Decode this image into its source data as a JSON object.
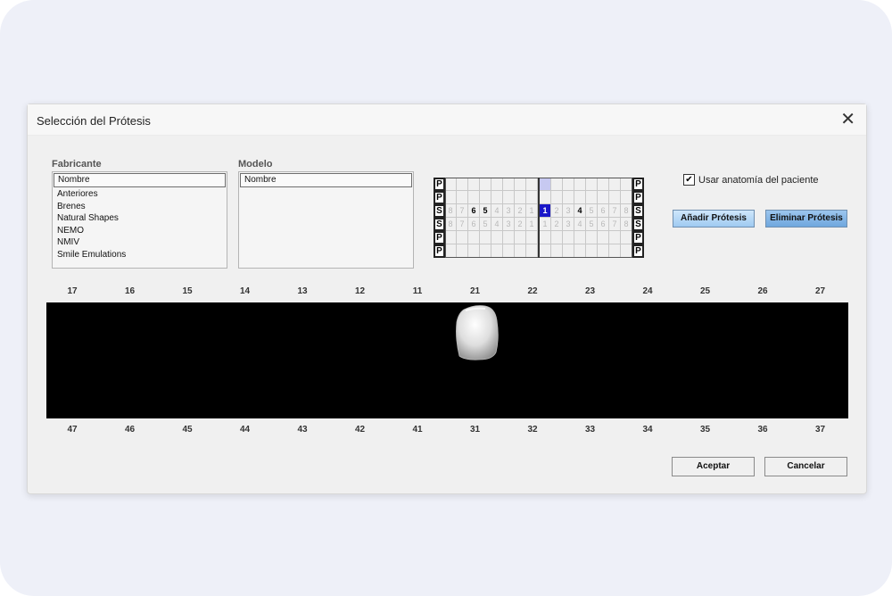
{
  "dialog": {
    "title": "Selección del Prótesis",
    "close_glyph": "✕"
  },
  "fabricante": {
    "label": "Fabricante",
    "header": "Nombre",
    "items": [
      "Anteriores",
      "Brenes",
      "Natural Shapes",
      "NEMO",
      "NMIV",
      "Smile Emulations"
    ]
  },
  "modelo": {
    "label": "Modelo",
    "header": "Nombre",
    "items": []
  },
  "tooth_grid": {
    "row_tags": [
      "P",
      "P",
      "S",
      "S",
      "P",
      "P"
    ],
    "upper_left": [
      "8",
      "7",
      "6",
      "5",
      "4",
      "3",
      "2",
      "1"
    ],
    "upper_right": [
      "1",
      "2",
      "3",
      "4",
      "5",
      "6",
      "7",
      "8"
    ],
    "lower_left": [
      "8",
      "7",
      "6",
      "5",
      "4",
      "3",
      "2",
      "1"
    ],
    "lower_right": [
      "1",
      "2",
      "3",
      "4",
      "5",
      "6",
      "7",
      "8"
    ],
    "selected_tooth": "upper-right-1",
    "emphasized_teeth": [
      "upper-left-6",
      "upper-left-5",
      "upper-right-4"
    ],
    "selected_color": "#1a17c8",
    "highlight_color": "#c7c9f1"
  },
  "options": {
    "use_patient_anatomy_label": "Usar anatomía del paciente",
    "use_patient_anatomy_checked": true,
    "check_glyph": "✔"
  },
  "buttons": {
    "add": "Añadir Prótesis",
    "remove": "Eliminar Prótesis",
    "accept": "Aceptar",
    "cancel": "Cancelar"
  },
  "upper_tooth_numbers": [
    "17",
    "16",
    "15",
    "14",
    "13",
    "12",
    "11",
    "21",
    "22",
    "23",
    "24",
    "25",
    "26",
    "27"
  ],
  "lower_tooth_numbers": [
    "47",
    "46",
    "45",
    "44",
    "43",
    "42",
    "41",
    "31",
    "32",
    "33",
    "34",
    "35",
    "36",
    "37"
  ],
  "colors": {
    "viewer_bg": "#000000",
    "button_blue_light": "#b9dcf7",
    "button_blue_dark": "#7fb4e6"
  }
}
